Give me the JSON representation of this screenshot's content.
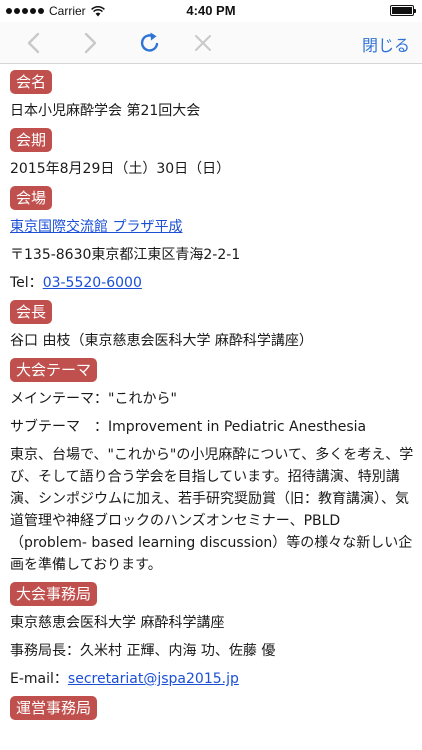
{
  "status": {
    "carrier": "Carrier",
    "time": "4:40 PM"
  },
  "toolbar": {
    "close_label": "閉じる"
  },
  "sections": {
    "kaimei": {
      "label": "会名",
      "name": "日本小児麻酔学会 第21回大会"
    },
    "kaiki": {
      "label": "会期",
      "date": "2015年8月29日（土）30日（日）"
    },
    "kaijo": {
      "label": "会場",
      "venue_link": "東京国際交流館 プラザ平成",
      "address": "〒135-8630東京都江東区青海2-2-1",
      "tel_prefix": "Tel：",
      "tel_link": "03-5520-6000"
    },
    "kaicho": {
      "label": "会長",
      "name": "谷口 由枝（東京慈恵会医科大学 麻酔科学講座）"
    },
    "theme": {
      "label": "大会テーマ",
      "main": "メインテーマ：\"これから\"",
      "sub": "サブテーマ　：Improvement in Pediatric Anesthesia",
      "description": "東京、台場で、\"これから\"の小児麻酔について、多くを考え、学び、そして語り合う学会を目指しています。招待講演、特別講演、シンポジウムに加え、若手研究奨励賞（旧：教育講演）、気道管理や神経ブロックのハンズオンセミナー、PBLD（problem- based learning discussion）等の様々な新しい企画を準備しております。"
    },
    "jimukyoku": {
      "label": "大会事務局",
      "org": "東京慈恵会医科大学 麻酔科学講座",
      "staff": "事務局長：久米村 正輝、内海 功、佐藤 優",
      "email_prefix": "E-mail：",
      "email_link": "secretariat@jspa2015.jp"
    },
    "unei": {
      "label": "運営事務局"
    }
  }
}
